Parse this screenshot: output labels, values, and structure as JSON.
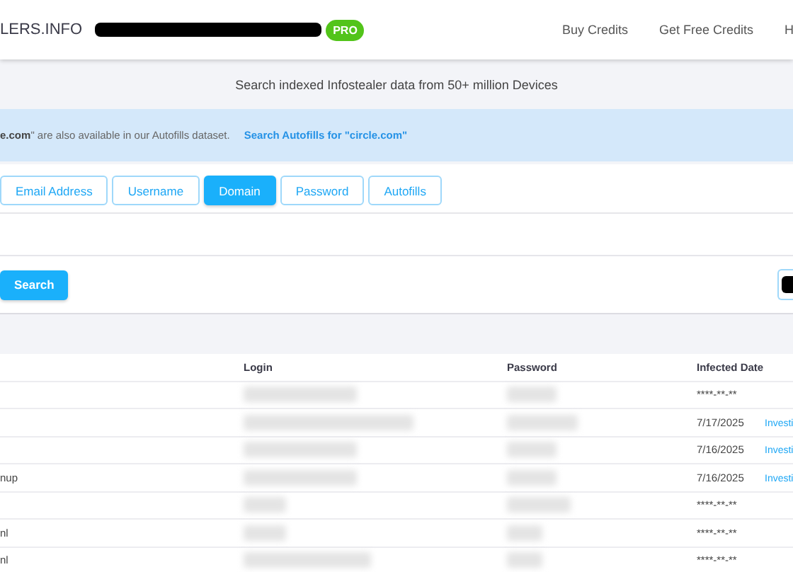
{
  "header": {
    "logo": "LERS.INFO",
    "badge": "PRO",
    "nav": [
      "Buy Credits",
      "Get Free Credits",
      "H"
    ]
  },
  "tagline": "Search indexed Infostealer data from 50+ million Devices",
  "notice": {
    "text": "**e.com**\" are also available in our Autofills dataset.",
    "link": "Search Autofills for \"circle.com\""
  },
  "tabs": [
    {
      "label": "Email Address",
      "selected": false
    },
    {
      "label": "Username",
      "selected": false
    },
    {
      "label": "Domain",
      "selected": true
    },
    {
      "label": "Password",
      "selected": false
    },
    {
      "label": "Autofills",
      "selected": false
    }
  ],
  "search_button": "Search",
  "table": {
    "columns": [
      "Login",
      "Password",
      "Infected Date"
    ],
    "rows": [
      {
        "date": "****-**-**"
      },
      {
        "date": "7/17/2025",
        "action": "Investi"
      },
      {
        "date": "7/16/2025",
        "action": "Investi"
      },
      {
        "column_1": "nup",
        "date": "7/16/2025",
        "action": "Investi"
      },
      {
        "date": "****-**-**"
      },
      {
        "column_1": "nl",
        "date": "****-**-**"
      },
      {
        "column_1": "nl",
        "date": "****-**-**"
      }
    ]
  }
}
